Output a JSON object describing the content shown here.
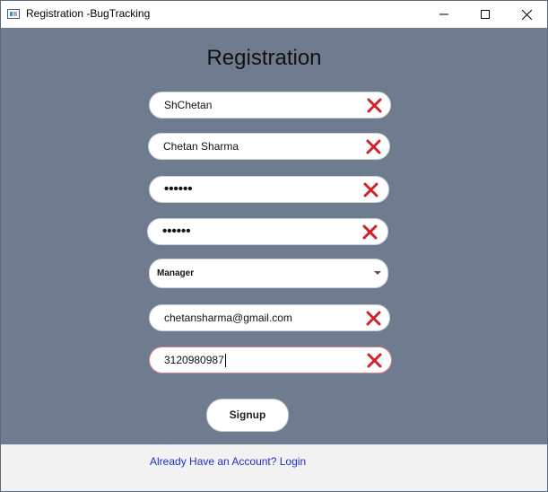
{
  "window": {
    "title": "Registration -BugTracking"
  },
  "form": {
    "heading": "Registration",
    "username": {
      "value": "ShChetan"
    },
    "full_name": {
      "value": "Chetan Sharma"
    },
    "password": {
      "value": "••••••"
    },
    "confirm_password": {
      "value": "••••••"
    },
    "role": {
      "selected": "Manager"
    },
    "email": {
      "value": "chetansharma@gmail.com"
    },
    "phone": {
      "value": "3120980987"
    },
    "signup_label": "Signup"
  },
  "footer": {
    "login_link": "Already Have an Account? Login"
  },
  "colors": {
    "background": "#6f7c8f",
    "clear_icon": "#d0222e",
    "link": "#1f2fd0"
  },
  "icons": {
    "clear": "close-icon",
    "dropdown": "chevron-down-icon"
  }
}
